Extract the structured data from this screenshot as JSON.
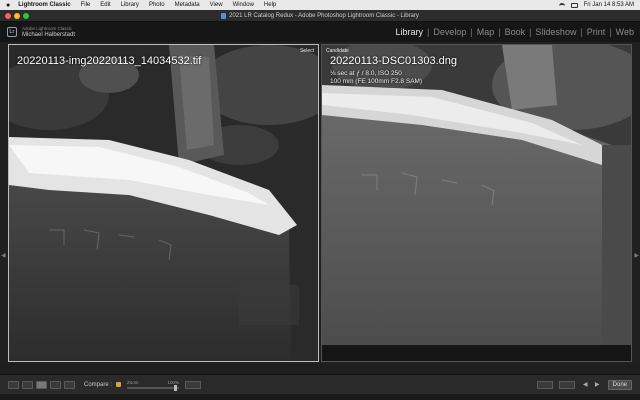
{
  "menubar": {
    "app_name": "Lightroom Classic",
    "items": [
      "File",
      "Edit",
      "Library",
      "Photo",
      "Metadata",
      "View",
      "Window",
      "Help"
    ],
    "clock": "Fri Jan 14  8:53 AM"
  },
  "window": {
    "title": "2021 LR Catalog Redux - Adobe Photoshop Lightroom Classic - Library"
  },
  "identity": {
    "logo": "Lr",
    "app_label": "Adobe Lightroom Classic",
    "user_name": "Michael Halberstadt"
  },
  "modules": [
    "Library",
    "Develop",
    "Map",
    "Book",
    "Slideshow",
    "Print",
    "Web"
  ],
  "active_module": "Library",
  "compare": {
    "select": {
      "tag": "Select",
      "filename": "20220113-img20220113_14034532.tif"
    },
    "candidate": {
      "tag": "Candidate",
      "filename": "20220113-DSC01303.dng",
      "meta_line1": "⅛ sec at ƒ / 8.0, ISO 250",
      "meta_line2": "100 mm (FE 100mm F2.8 SAM)"
    }
  },
  "toolbar": {
    "compare_label": "Compare :",
    "zoom_label": "Zoom",
    "zoom_value": "100%",
    "zoom_fraction": 0.9,
    "done_label": "Done"
  },
  "colors": {
    "lock": "#d4a636",
    "active_module": "#e6e6e6",
    "inactive_module": "#8a8a8a"
  }
}
